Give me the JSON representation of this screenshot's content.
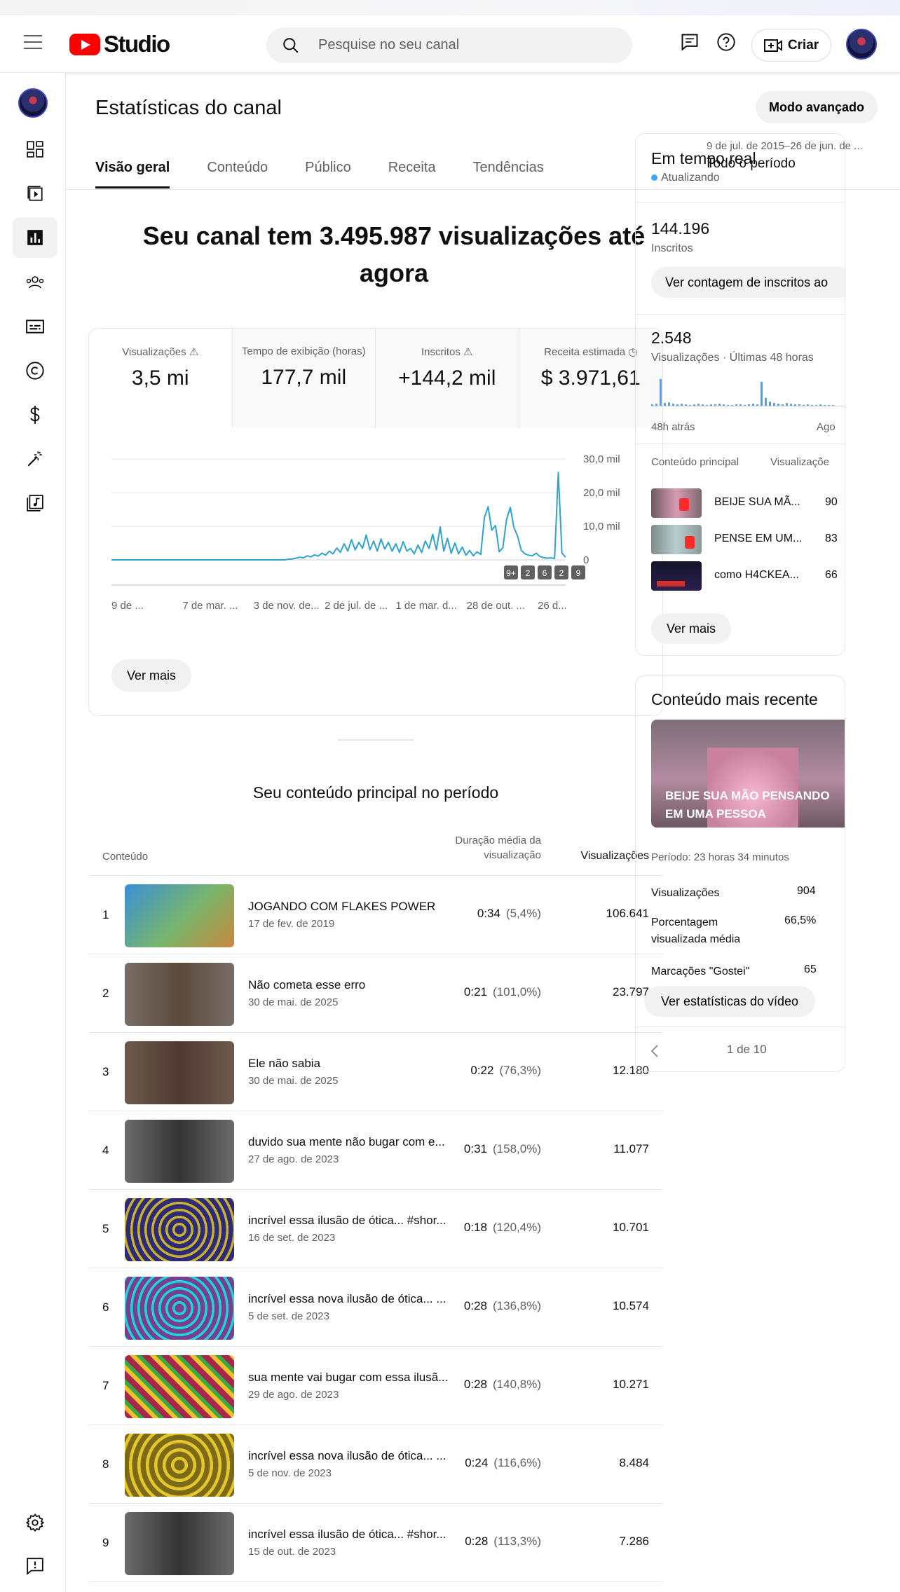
{
  "header": {
    "logo_text": "Studio",
    "search_placeholder": "Pesquise no seu canal",
    "create_label": "Criar"
  },
  "page": {
    "title": "Estatísticas do canal",
    "advanced_mode": "Modo avançado",
    "tabs": [
      "Visão geral",
      "Conteúdo",
      "Público",
      "Receita",
      "Tendências"
    ],
    "period_range": "9 de jul. de 2015–26 de jun. de ...",
    "period_label": "Todo o período"
  },
  "overview": {
    "headline": "Seu canal tem 3.495.987 visualizações até agora",
    "metrics": [
      {
        "label": "Visualizações",
        "value": "3,5 mi"
      },
      {
        "label": "Tempo de exibição (horas)",
        "value": "177,7 mil"
      },
      {
        "label": "Inscritos",
        "value": "+144,2 mil"
      },
      {
        "label": "Receita estimada",
        "value": "$ 3.971,61"
      }
    ],
    "see_more": "Ver mais"
  },
  "chart_data": {
    "type": "line",
    "x": [
      "9 de ...",
      "7 de mar. ...",
      "3 de nov. de...",
      "2 de jul. de ...",
      "1 de mar. d...",
      "28 de out. ...",
      "26 d..."
    ],
    "y_ticks": [
      "30,0 mil",
      "20,0 mil",
      "10,0 mil",
      "0"
    ],
    "ylim": [
      0,
      30000
    ],
    "grid": true,
    "series": [
      {
        "values": [
          0,
          0,
          0,
          0,
          0,
          0,
          0,
          0,
          0,
          0,
          0,
          0,
          0,
          0,
          0,
          0,
          0,
          0,
          0,
          0,
          0,
          0,
          0,
          0,
          0,
          0,
          0,
          0,
          0,
          0,
          0,
          0,
          0,
          0,
          0,
          0,
          0,
          0,
          0,
          0,
          0,
          0,
          0,
          0,
          0,
          0,
          0,
          0,
          200,
          300,
          500,
          800,
          600,
          1200,
          900,
          1500,
          1100,
          2000,
          1400,
          2600,
          1800,
          3500,
          2200,
          4800,
          2600,
          6000,
          3000,
          5200,
          3400,
          7400,
          3000,
          5600,
          2600,
          6200,
          3200,
          5200,
          2600,
          4800,
          2200,
          5400,
          2600,
          3400,
          1800,
          4400,
          2200,
          5600,
          3400,
          7600,
          3000,
          9800,
          2600,
          6400,
          2000,
          5000,
          1800,
          3800,
          1400,
          2800,
          1200,
          2400,
          1600,
          12600,
          15800,
          8800,
          10200,
          2400,
          3600,
          12000,
          15600,
          9600,
          7000,
          2800,
          1800,
          1400,
          1200,
          2000,
          1000,
          700,
          500,
          600,
          400,
          26000,
          2000,
          800
        ]
      }
    ],
    "annotation_markers": [
      "9+",
      "2",
      "6",
      "2",
      "9"
    ]
  },
  "top_content": {
    "title": "Seu conteúdo principal no período",
    "col_content": "Conteúdo",
    "col_avg_duration": "Duração média da visualização",
    "col_views": "Visualizações",
    "rows": [
      {
        "n": "1",
        "title": "JOGANDO COM FLAKES POWER",
        "date": "17 de fev. de 2019",
        "dur": "0:34",
        "pct": "(5,4%)",
        "views": "106.641"
      },
      {
        "n": "2",
        "title": "Não cometa esse erro",
        "date": "30 de mai. de 2025",
        "dur": "0:21",
        "pct": "(101,0%)",
        "views": "23.797"
      },
      {
        "n": "3",
        "title": "Ele não sabia",
        "date": "30 de mai. de 2025",
        "dur": "0:22",
        "pct": "(76,3%)",
        "views": "12.180"
      },
      {
        "n": "4",
        "title": "duvido sua mente não bugar com e...",
        "date": "27 de ago. de 2023",
        "dur": "0:31",
        "pct": "(158,0%)",
        "views": "11.077"
      },
      {
        "n": "5",
        "title": "incrível essa ilusão de ótica... #shor...",
        "date": "16 de set. de 2023",
        "dur": "0:18",
        "pct": "(120,4%)",
        "views": "10.701"
      },
      {
        "n": "6",
        "title": "incrível essa nova ilusão de ótica... ...",
        "date": "5 de set. de 2023",
        "dur": "0:28",
        "pct": "(136,8%)",
        "views": "10.574"
      },
      {
        "n": "7",
        "title": "sua mente vai bugar com essa ilusã...",
        "date": "29 de ago. de 2023",
        "dur": "0:28",
        "pct": "(140,8%)",
        "views": "10.271"
      },
      {
        "n": "8",
        "title": "incrível essa nova ilusão de ótica... ...",
        "date": "5 de nov. de 2023",
        "dur": "0:24",
        "pct": "(116,6%)",
        "views": "8.484"
      },
      {
        "n": "9",
        "title": "incrível essa ilusão de ótica... #shor...",
        "date": "15 de out. de 2023",
        "dur": "0:28",
        "pct": "(113,3%)",
        "views": "7.286"
      }
    ]
  },
  "realtime": {
    "title": "Em tempo real",
    "status": "Atualizando",
    "subs_value": "144.196",
    "subs_label": "Inscritos",
    "subs_button": "Ver contagem de inscritos ao",
    "views_value": "2.548",
    "views_label": "Visualizações · Últimas 48 horas",
    "axis_left": "48h atrás",
    "axis_right": "Ago",
    "col_content": "Conteúdo principal",
    "col_views": "Visualizaçõe",
    "items": [
      {
        "title": "BEIJE SUA MÃ...",
        "views": "90"
      },
      {
        "title": "PENSE EM UM...",
        "views": "83"
      },
      {
        "title": "como H4CKEA...",
        "views": "66"
      }
    ],
    "see_more": "Ver mais"
  },
  "recent": {
    "title": "Conteúdo mais recente",
    "video_title": "BEIJE SUA MÃO PENSANDO EM UMA PESSOA",
    "period": "Período: 23 horas 34 minutos",
    "stats": [
      {
        "label": "Visualizações",
        "value": "904"
      },
      {
        "label": "Porcentagem visualizada média",
        "value": "66,5%"
      },
      {
        "label": "Marcações \"Gostei\"",
        "value": "65"
      }
    ],
    "button": "Ver estatísticas do vídeo",
    "pager": "1 de 10"
  },
  "colors": {
    "accent": "#3ea6ff",
    "chart_line": "#2fa3cf",
    "brand_red": "#ff0000"
  }
}
